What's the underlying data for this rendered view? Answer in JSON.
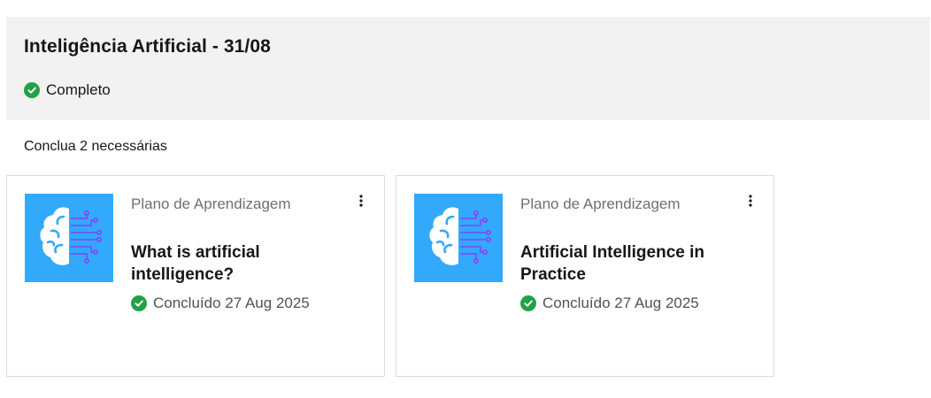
{
  "header": {
    "title": "Inteligência Artificial - 31/08",
    "status_label": "Completo"
  },
  "requirement_text": "Conclua 2 necessárias",
  "cards": [
    {
      "type_label": "Plano de Aprendizagem",
      "title": "What is artificial intelligence?",
      "status_label": "Concluído 27 Aug 2025",
      "thumbnail_icon": "brain-circuit-icon"
    },
    {
      "type_label": "Plano de Aprendizagem",
      "title": "Artificial Intelligence in Practice",
      "status_label": "Concluído 27 Aug 2025",
      "thumbnail_icon": "brain-circuit-icon"
    }
  ],
  "colors": {
    "header_background": "#f2f2f2",
    "success_green": "#24a148",
    "thumbnail_blue": "#33a9fb",
    "circuit_purple": "#8a3ffc"
  }
}
